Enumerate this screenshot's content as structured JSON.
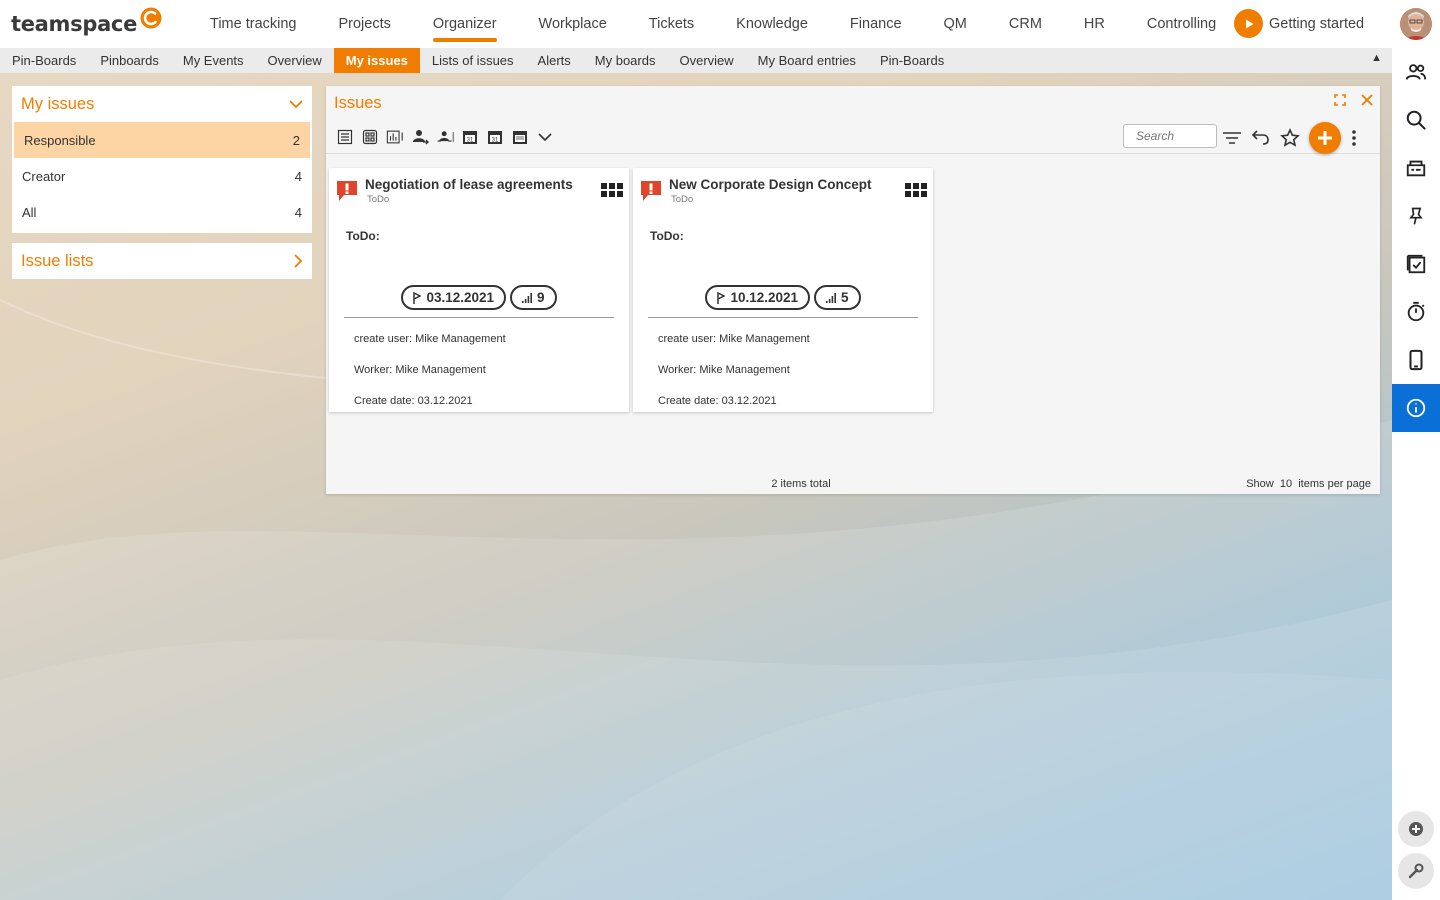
{
  "app": {
    "logo_text": "teamspace",
    "nav": [
      "Time tracking",
      "Projects",
      "Organizer",
      "Workplace",
      "Tickets",
      "Knowledge",
      "Finance",
      "QM",
      "CRM",
      "HR",
      "Controlling"
    ],
    "active_nav": "Organizer",
    "getting_started": "Getting started",
    "accent_color": "#f07d00",
    "info_color": "#0a6fd6"
  },
  "subnav": {
    "items": [
      "Pin-Boards",
      "Pinboards",
      "My Events",
      "Overview",
      "My issues",
      "Lists of issues",
      "Alerts",
      "My boards",
      "Overview",
      "My Board entries",
      "Pin-Boards"
    ],
    "active": "My issues",
    "collapse_icon": "▲"
  },
  "sidebar": {
    "my_issues": {
      "title": "My issues",
      "rows": [
        {
          "label": "Responsible",
          "count": "2"
        },
        {
          "label": "Creator",
          "count": "4"
        },
        {
          "label": "All",
          "count": "4"
        }
      ]
    },
    "issue_lists": {
      "title": "Issue lists"
    }
  },
  "issues": {
    "title": "Issues",
    "search_placeholder": "Search",
    "cards": [
      {
        "title": "Negotiation of lease agreements",
        "status": "ToDo",
        "todo_label": "ToDo:",
        "date": "03.12.2021",
        "priority": "9",
        "create_user": "create user: Mike Management",
        "worker": "Worker: Mike Management",
        "create_date": "Create date: 03.12.2021"
      },
      {
        "title": "New Corporate Design Concept",
        "status": "ToDo",
        "todo_label": "ToDo:",
        "date": "10.12.2021",
        "priority": "5",
        "create_user": "create user: Mike Management",
        "worker": "Worker: Mike Management",
        "create_date": "Create date: 03.12.2021"
      }
    ],
    "total": "2 items total",
    "per_page_show": "Show",
    "per_page_value": "10",
    "per_page_suffix": "items per page"
  }
}
